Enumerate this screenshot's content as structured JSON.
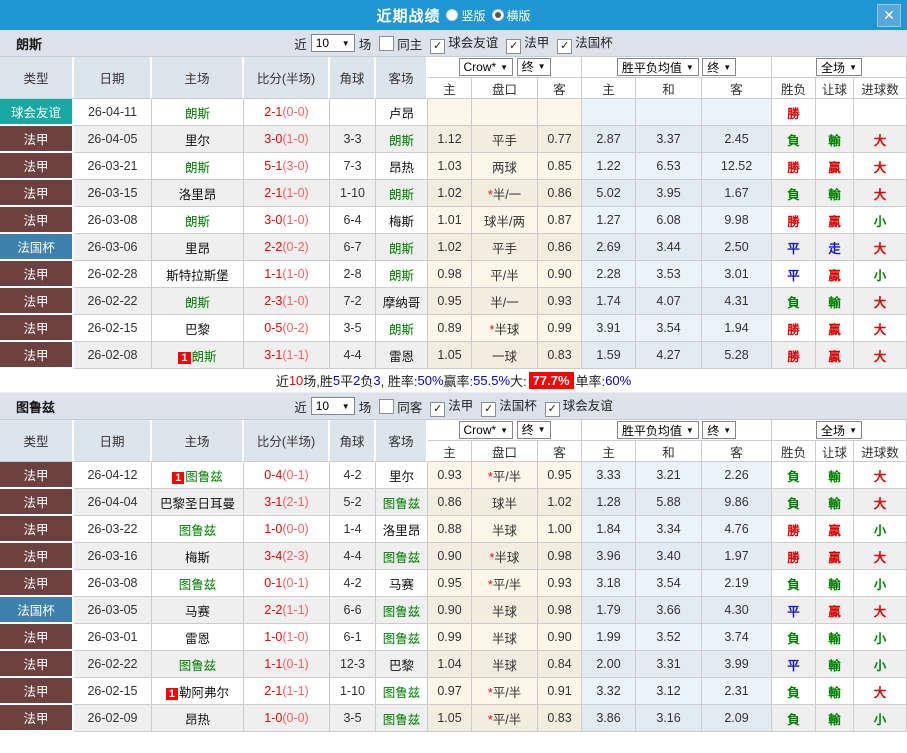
{
  "titlebar": {
    "title": "近期战绩",
    "radio_vertical": "竖版",
    "radio_horizontal": "横版",
    "close": "✕"
  },
  "filter_common": {
    "near": "近",
    "count": "10",
    "games": "场"
  },
  "dropdowns": {
    "bookmaker": "Crow*",
    "final": "终",
    "avg": "胜平负均值",
    "final2": "终",
    "scope": "全场",
    "arrow": "▼"
  },
  "columns": {
    "type": "类型",
    "date": "日期",
    "home": "主场",
    "score": "比分(半场)",
    "corner": "角球",
    "away": "客场",
    "odds_home": "主",
    "handicap": "盘口",
    "odds_away": "客",
    "avg_home": "主",
    "avg_draw": "和",
    "avg_away": "客",
    "wdl": "胜负",
    "let_goal": "让球",
    "goals": "进球数"
  },
  "colors": {
    "titlebar_blue": "#1e97d4",
    "league_maroon": "#6e4141",
    "cup_blue": "#3e81ae",
    "friendly_teal": "#17a8a2",
    "win_red": "#d90000",
    "lose_green": "#008000",
    "draw_blue": "#1414cc",
    "score_red": "#f20000"
  },
  "section1": {
    "team": "朗斯",
    "same_label": "同主",
    "same_checked": false,
    "filters": [
      {
        "label": "球会友谊",
        "checked": true
      },
      {
        "label": "法甲",
        "checked": true
      },
      {
        "label": "法国杯",
        "checked": true
      }
    ],
    "rows": [
      {
        "type": "球会友谊",
        "tc": "friendly",
        "date": "26-04-11",
        "hb": "",
        "home": "朗斯",
        "hs": true,
        "ft": "2-1",
        "ht": "(0-0)",
        "ck": "",
        "away": "卢昂",
        "as": false,
        "o1": "",
        "st": "",
        "hc": "",
        "o2": "",
        "m1": "",
        "m2": "",
        "m3": "",
        "r1": "勝",
        "c1": "r",
        "r2": "",
        "c2": "",
        "r3": "",
        "c3": ""
      },
      {
        "type": "法甲",
        "tc": "league",
        "date": "26-04-05",
        "hb": "",
        "home": "里尔",
        "hs": false,
        "ft": "3-0",
        "ht": "(1-0)",
        "ck": "3-3",
        "away": "朗斯",
        "as": true,
        "o1": "1.12",
        "st": "",
        "hc": "平手",
        "o2": "0.77",
        "m1": "2.87",
        "m2": "3.37",
        "m3": "2.45",
        "r1": "負",
        "c1": "g",
        "r2": "輸",
        "c2": "g",
        "r3": "大",
        "c3": "r"
      },
      {
        "type": "法甲",
        "tc": "league",
        "date": "26-03-21",
        "hb": "",
        "home": "朗斯",
        "hs": true,
        "ft": "5-1",
        "ht": "(3-0)",
        "ck": "7-3",
        "away": "昂热",
        "as": false,
        "o1": "1.03",
        "st": "",
        "hc": "两球",
        "o2": "0.85",
        "m1": "1.22",
        "m2": "6.53",
        "m3": "12.52",
        "r1": "勝",
        "c1": "r",
        "r2": "贏",
        "c2": "r",
        "r3": "大",
        "c3": "r"
      },
      {
        "type": "法甲",
        "tc": "league",
        "date": "26-03-15",
        "hb": "",
        "home": "洛里昂",
        "hs": false,
        "ft": "2-1",
        "ht": "(1-0)",
        "ck": "1-10",
        "away": "朗斯",
        "as": true,
        "o1": "1.02",
        "st": "*",
        "hc": "半/一",
        "o2": "0.86",
        "m1": "5.02",
        "m2": "3.95",
        "m3": "1.67",
        "r1": "負",
        "c1": "g",
        "r2": "輸",
        "c2": "g",
        "r3": "大",
        "c3": "r"
      },
      {
        "type": "法甲",
        "tc": "league",
        "date": "26-03-08",
        "hb": "",
        "home": "朗斯",
        "hs": true,
        "ft": "3-0",
        "ht": "(1-0)",
        "ck": "6-4",
        "away": "梅斯",
        "as": false,
        "o1": "1.01",
        "st": "",
        "hc": "球半/两",
        "o2": "0.87",
        "m1": "1.27",
        "m2": "6.08",
        "m3": "9.98",
        "r1": "勝",
        "c1": "r",
        "r2": "贏",
        "c2": "r",
        "r3": "小",
        "c3": "g"
      },
      {
        "type": "法国杯",
        "tc": "cup",
        "date": "26-03-06",
        "hb": "",
        "home": "里昂",
        "hs": false,
        "ft": "2-2",
        "ht": "(0-2)",
        "ck": "6-7",
        "away": "朗斯",
        "as": true,
        "o1": "1.02",
        "st": "",
        "hc": "平手",
        "o2": "0.86",
        "m1": "2.69",
        "m2": "3.44",
        "m3": "2.50",
        "r1": "平",
        "c1": "b",
        "r2": "走",
        "c2": "b",
        "r3": "大",
        "c3": "r"
      },
      {
        "type": "法甲",
        "tc": "league",
        "date": "26-02-28",
        "hb": "",
        "home": "斯特拉斯堡",
        "hs": false,
        "ft": "1-1",
        "ht": "(1-0)",
        "ck": "2-8",
        "away": "朗斯",
        "as": true,
        "o1": "0.98",
        "st": "",
        "hc": "平/半",
        "o2": "0.90",
        "m1": "2.28",
        "m2": "3.53",
        "m3": "3.01",
        "r1": "平",
        "c1": "b",
        "r2": "贏",
        "c2": "r",
        "r3": "小",
        "c3": "g"
      },
      {
        "type": "法甲",
        "tc": "league",
        "date": "26-02-22",
        "hb": "",
        "home": "朗斯",
        "hs": true,
        "ft": "2-3",
        "ht": "(1-0)",
        "ck": "7-2",
        "away": "摩纳哥",
        "as": false,
        "o1": "0.95",
        "st": "",
        "hc": "半/一",
        "o2": "0.93",
        "m1": "1.74",
        "m2": "4.07",
        "m3": "4.31",
        "r1": "負",
        "c1": "g",
        "r2": "輸",
        "c2": "g",
        "r3": "大",
        "c3": "r"
      },
      {
        "type": "法甲",
        "tc": "league",
        "date": "26-02-15",
        "hb": "",
        "home": "巴黎",
        "hs": false,
        "ft": "0-5",
        "ht": "(0-2)",
        "ck": "3-5",
        "away": "朗斯",
        "as": true,
        "o1": "0.89",
        "st": "*",
        "hc": "半球",
        "o2": "0.99",
        "m1": "3.91",
        "m2": "3.54",
        "m3": "1.94",
        "r1": "勝",
        "c1": "r",
        "r2": "贏",
        "c2": "r",
        "r3": "大",
        "c3": "r"
      },
      {
        "type": "法甲",
        "tc": "league",
        "date": "26-02-08",
        "hb": "1",
        "home": "朗斯",
        "hs": true,
        "ft": "3-1",
        "ht": "(1-1)",
        "ck": "4-4",
        "away": "雷恩",
        "as": false,
        "o1": "1.05",
        "st": "",
        "hc": "一球",
        "o2": "0.83",
        "m1": "1.59",
        "m2": "4.27",
        "m3": "5.28",
        "r1": "勝",
        "c1": "r",
        "r2": "贏",
        "c2": "r",
        "r3": "大",
        "c3": "r"
      }
    ],
    "summary": [
      {
        "t": "近",
        "c": "k"
      },
      {
        "t": "10",
        "c": "r"
      },
      {
        "t": "场,胜",
        "c": "k"
      },
      {
        "t": "5",
        "c": "b"
      },
      {
        "t": "平",
        "c": "k"
      },
      {
        "t": "2",
        "c": "b"
      },
      {
        "t": "负",
        "c": "k"
      },
      {
        "t": "3",
        "c": "b"
      },
      {
        "t": ", 胜率:",
        "c": "k"
      },
      {
        "t": "50%",
        "c": "b"
      },
      {
        "t": " 赢率:",
        "c": "k"
      },
      {
        "t": "55.5%",
        "c": "b"
      },
      {
        "t": " 大: ",
        "c": "k"
      },
      {
        "t": "77.7%",
        "c": "rb"
      },
      {
        "t": " 单率:",
        "c": "k"
      },
      {
        "t": "60%",
        "c": "b"
      }
    ]
  },
  "section2": {
    "team": "图鲁兹",
    "same_label": "同客",
    "same_checked": false,
    "filters": [
      {
        "label": "法甲",
        "checked": true
      },
      {
        "label": "法国杯",
        "checked": true
      },
      {
        "label": "球会友谊",
        "checked": true
      }
    ],
    "rows": [
      {
        "type": "法甲",
        "tc": "league",
        "date": "26-04-12",
        "hb": "1",
        "home": "图鲁兹",
        "hs": true,
        "ft": "0-4",
        "ht": "(0-1)",
        "ck": "4-2",
        "away": "里尔",
        "as": false,
        "o1": "0.93",
        "st": "*",
        "hc": "平/半",
        "o2": "0.95",
        "m1": "3.33",
        "m2": "3.21",
        "m3": "2.26",
        "r1": "負",
        "c1": "g",
        "r2": "輸",
        "c2": "g",
        "r3": "大",
        "c3": "r"
      },
      {
        "type": "法甲",
        "tc": "league",
        "date": "26-04-04",
        "hb": "",
        "home": "巴黎圣日耳曼",
        "hs": false,
        "ft": "3-1",
        "ht": "(2-1)",
        "ck": "5-2",
        "away": "图鲁兹",
        "as": true,
        "o1": "0.86",
        "st": "",
        "hc": "球半",
        "o2": "1.02",
        "m1": "1.28",
        "m2": "5.88",
        "m3": "9.86",
        "r1": "負",
        "c1": "g",
        "r2": "輸",
        "c2": "g",
        "r3": "大",
        "c3": "r"
      },
      {
        "type": "法甲",
        "tc": "league",
        "date": "26-03-22",
        "hb": "",
        "home": "图鲁兹",
        "hs": true,
        "ft": "1-0",
        "ht": "(0-0)",
        "ck": "1-4",
        "away": "洛里昂",
        "as": false,
        "o1": "0.88",
        "st": "",
        "hc": "半球",
        "o2": "1.00",
        "m1": "1.84",
        "m2": "3.34",
        "m3": "4.76",
        "r1": "勝",
        "c1": "r",
        "r2": "贏",
        "c2": "r",
        "r3": "小",
        "c3": "g"
      },
      {
        "type": "法甲",
        "tc": "league",
        "date": "26-03-16",
        "hb": "",
        "home": "梅斯",
        "hs": false,
        "ft": "3-4",
        "ht": "(2-3)",
        "ck": "4-4",
        "away": "图鲁兹",
        "as": true,
        "o1": "0.90",
        "st": "*",
        "hc": "半球",
        "o2": "0.98",
        "m1": "3.96",
        "m2": "3.40",
        "m3": "1.97",
        "r1": "勝",
        "c1": "r",
        "r2": "贏",
        "c2": "r",
        "r3": "大",
        "c3": "r"
      },
      {
        "type": "法甲",
        "tc": "league",
        "date": "26-03-08",
        "hb": "",
        "home": "图鲁兹",
        "hs": true,
        "ft": "0-1",
        "ht": "(0-1)",
        "ck": "4-2",
        "away": "马赛",
        "as": false,
        "o1": "0.95",
        "st": "*",
        "hc": "平/半",
        "o2": "0.93",
        "m1": "3.18",
        "m2": "3.54",
        "m3": "2.19",
        "r1": "負",
        "c1": "g",
        "r2": "輸",
        "c2": "g",
        "r3": "小",
        "c3": "g"
      },
      {
        "type": "法国杯",
        "tc": "cup",
        "date": "26-03-05",
        "hb": "",
        "home": "马赛",
        "hs": false,
        "ft": "2-2",
        "ht": "(1-1)",
        "ck": "6-6",
        "away": "图鲁兹",
        "as": true,
        "o1": "0.90",
        "st": "",
        "hc": "半球",
        "o2": "0.98",
        "m1": "1.79",
        "m2": "3.66",
        "m3": "4.30",
        "r1": "平",
        "c1": "b",
        "r2": "贏",
        "c2": "r",
        "r3": "大",
        "c3": "r"
      },
      {
        "type": "法甲",
        "tc": "league",
        "date": "26-03-01",
        "hb": "",
        "home": "雷恩",
        "hs": false,
        "ft": "1-0",
        "ht": "(1-0)",
        "ck": "6-1",
        "away": "图鲁兹",
        "as": true,
        "o1": "0.99",
        "st": "",
        "hc": "半球",
        "o2": "0.90",
        "m1": "1.99",
        "m2": "3.52",
        "m3": "3.74",
        "r1": "負",
        "c1": "g",
        "r2": "輸",
        "c2": "g",
        "r3": "小",
        "c3": "g"
      },
      {
        "type": "法甲",
        "tc": "league",
        "date": "26-02-22",
        "hb": "",
        "home": "图鲁兹",
        "hs": true,
        "ft": "1-1",
        "ht": "(0-1)",
        "ck": "12-3",
        "away": "巴黎",
        "as": false,
        "o1": "1.04",
        "st": "",
        "hc": "半球",
        "o2": "0.84",
        "m1": "2.00",
        "m2": "3.31",
        "m3": "3.99",
        "r1": "平",
        "c1": "b",
        "r2": "輸",
        "c2": "g",
        "r3": "小",
        "c3": "g"
      },
      {
        "type": "法甲",
        "tc": "league",
        "date": "26-02-15",
        "hb": "1",
        "home": "勒阿弗尔",
        "hs": false,
        "ft": "2-1",
        "ht": "(1-1)",
        "ck": "1-10",
        "away": "图鲁兹",
        "as": true,
        "o1": "0.97",
        "st": "*",
        "hc": "平/半",
        "o2": "0.91",
        "m1": "3.32",
        "m2": "3.12",
        "m3": "2.31",
        "r1": "負",
        "c1": "g",
        "r2": "輸",
        "c2": "g",
        "r3": "大",
        "c3": "r"
      },
      {
        "type": "法甲",
        "tc": "league",
        "date": "26-02-09",
        "hb": "",
        "home": "昂热",
        "hs": false,
        "ft": "1-0",
        "ht": "(0-0)",
        "ck": "3-5",
        "away": "图鲁兹",
        "as": true,
        "o1": "1.05",
        "st": "*",
        "hc": "平/半",
        "o2": "0.83",
        "m1": "3.86",
        "m2": "3.16",
        "m3": "2.09",
        "r1": "負",
        "c1": "g",
        "r2": "輸",
        "c2": "g",
        "r3": "小",
        "c3": "g"
      }
    ]
  }
}
